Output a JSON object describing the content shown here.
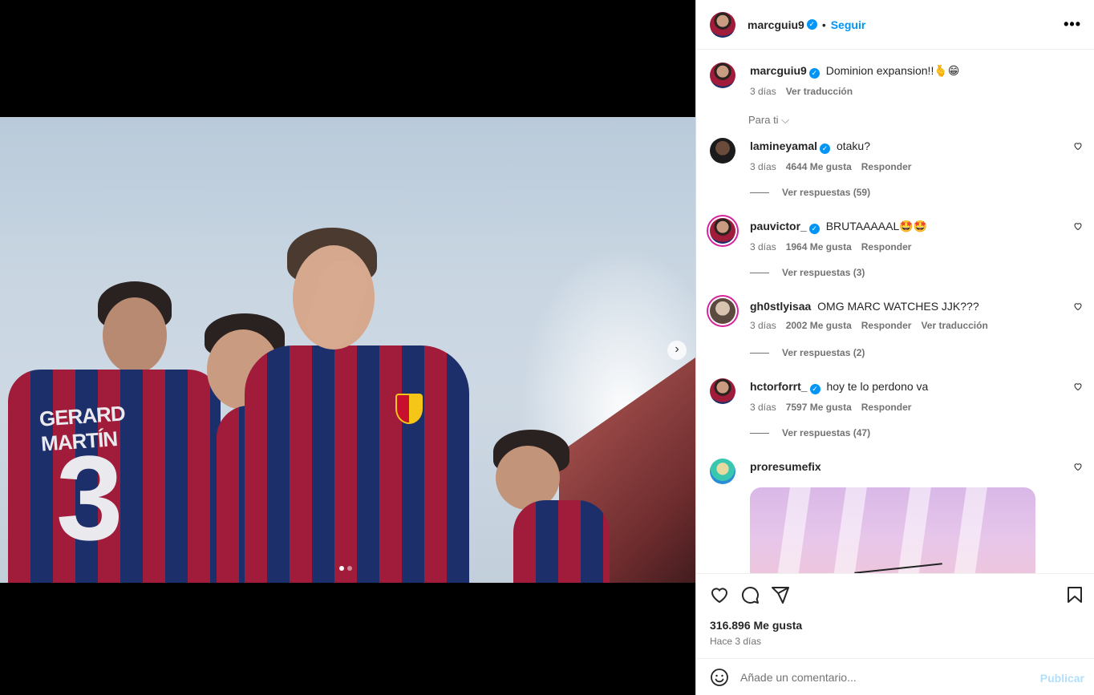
{
  "post": {
    "author": "marcguiu9",
    "follow_label": "Seguir",
    "separator": "•",
    "more_label": "•••",
    "caption": "Dominion expansion!!🫰😁",
    "caption_time": "3 días",
    "caption_translate": "Ver traducción",
    "sort_label": "Para ti ⌵",
    "likes": "316.896 Me gusta",
    "ago": "Hace 3 días",
    "comment_placeholder": "Añade un comentario...",
    "publish_label": "Publicar",
    "photo": {
      "name_print": "GERARD MARTÍN",
      "number_print": "3"
    }
  },
  "comments": [
    {
      "user": "lamineyamal",
      "verified": "✓",
      "text": "otaku?",
      "time": "3 días",
      "likes": "4644 Me gusta",
      "reply": "Responder",
      "translate": "",
      "replies": "Ver respuestas (59)"
    },
    {
      "user": "pauvictor_",
      "verified": "✓",
      "text": "BRUTAAAAAL🤩🤩",
      "time": "3 días",
      "likes": "1964 Me gusta",
      "reply": "Responder",
      "translate": "",
      "replies": "Ver respuestas (3)"
    },
    {
      "user": "gh0stlyisaa",
      "verified": "",
      "text": "OMG MARC WATCHES JJK???",
      "time": "3 días",
      "likes": "2002 Me gusta",
      "reply": "Responder",
      "translate": "Ver traducción",
      "replies": "Ver respuestas (2)"
    },
    {
      "user": "hctorforrt_",
      "verified": "✓",
      "text": "hoy te lo perdono va",
      "time": "3 días",
      "likes": "7597 Me gusta",
      "reply": "Responder",
      "translate": "",
      "replies": "Ver respuestas (47)"
    },
    {
      "user": "proresumefix",
      "verified": "",
      "text": "",
      "time": "",
      "likes": "",
      "reply": "",
      "translate": "",
      "replies": ""
    }
  ],
  "carousel": {
    "current": 1,
    "total": 2,
    "next_icon": "chevron-right-icon"
  },
  "colors": {
    "accent": "#0095f6",
    "verified": "#0095f6",
    "muted": "#737373"
  }
}
